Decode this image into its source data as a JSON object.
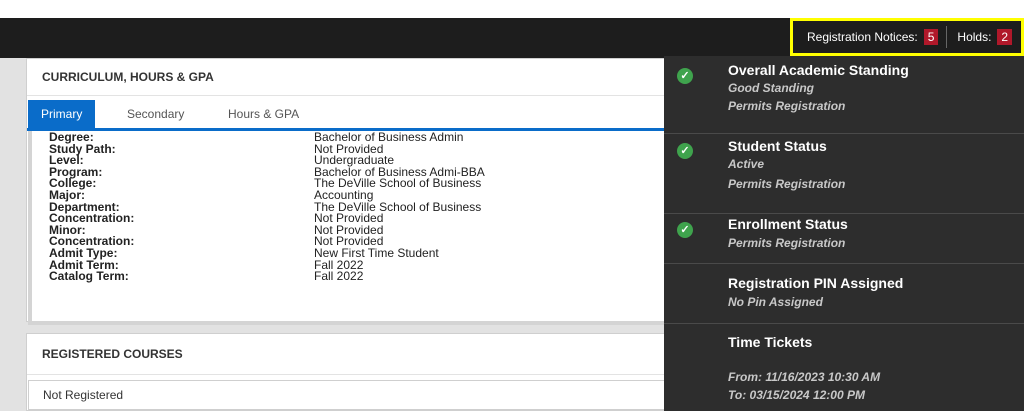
{
  "header": {
    "registration_notices_label": "Registration Notices:",
    "registration_notices_count": "5",
    "holds_label": "Holds:",
    "holds_count": "2"
  },
  "curriculum": {
    "title": "CURRICULUM, HOURS & GPA",
    "tabs": [
      "Primary",
      "Secondary",
      "Hours & GPA"
    ],
    "rows": [
      {
        "label": "Degree:",
        "value": "Bachelor of Business Admin"
      },
      {
        "label": "Study Path:",
        "value": "Not Provided"
      },
      {
        "label": "Level:",
        "value": "Undergraduate"
      },
      {
        "label": "Program:",
        "value": "Bachelor of Business Admi-BBA"
      },
      {
        "label": "College:",
        "value": "The DeVille School of Business"
      },
      {
        "label": "Major:",
        "value": "Accounting"
      },
      {
        "label": "Department:",
        "value": "The DeVille School of Business"
      },
      {
        "label": "Concentration:",
        "value": "Not Provided"
      },
      {
        "label": "Minor:",
        "value": "Not Provided"
      },
      {
        "label": "Concentration:",
        "value": "Not Provided"
      },
      {
        "label": "Admit Type:",
        "value": "New First Time Student"
      },
      {
        "label": "Admit Term:",
        "value": "Fall 2022"
      },
      {
        "label": "Catalog Term:",
        "value": "Fall 2022"
      }
    ]
  },
  "registered": {
    "title": "REGISTERED COURSES",
    "empty_text": "Not Registered"
  },
  "status": {
    "items": [
      {
        "title": "Overall Academic Standing",
        "lines": [
          "Good Standing",
          "Permits Registration"
        ],
        "icon": "check-icon"
      },
      {
        "title": "Student Status",
        "lines": [
          "Active",
          "Permits Registration"
        ],
        "icon": "check-icon"
      },
      {
        "title": "Enrollment Status",
        "lines": [
          "Permits Registration"
        ],
        "icon": "check-icon"
      },
      {
        "title": "Registration PIN Assigned",
        "lines": [
          "No Pin Assigned"
        ]
      },
      {
        "title": "Time Tickets",
        "lines": [
          "From: 11/16/2023 10:30 AM",
          "To: 03/15/2024 12:00 PM"
        ]
      }
    ]
  },
  "colors": {
    "accent": "#0a6cc9",
    "badge": "#b0182a",
    "highlight": "#ffff00",
    "check": "#3fa34d"
  }
}
